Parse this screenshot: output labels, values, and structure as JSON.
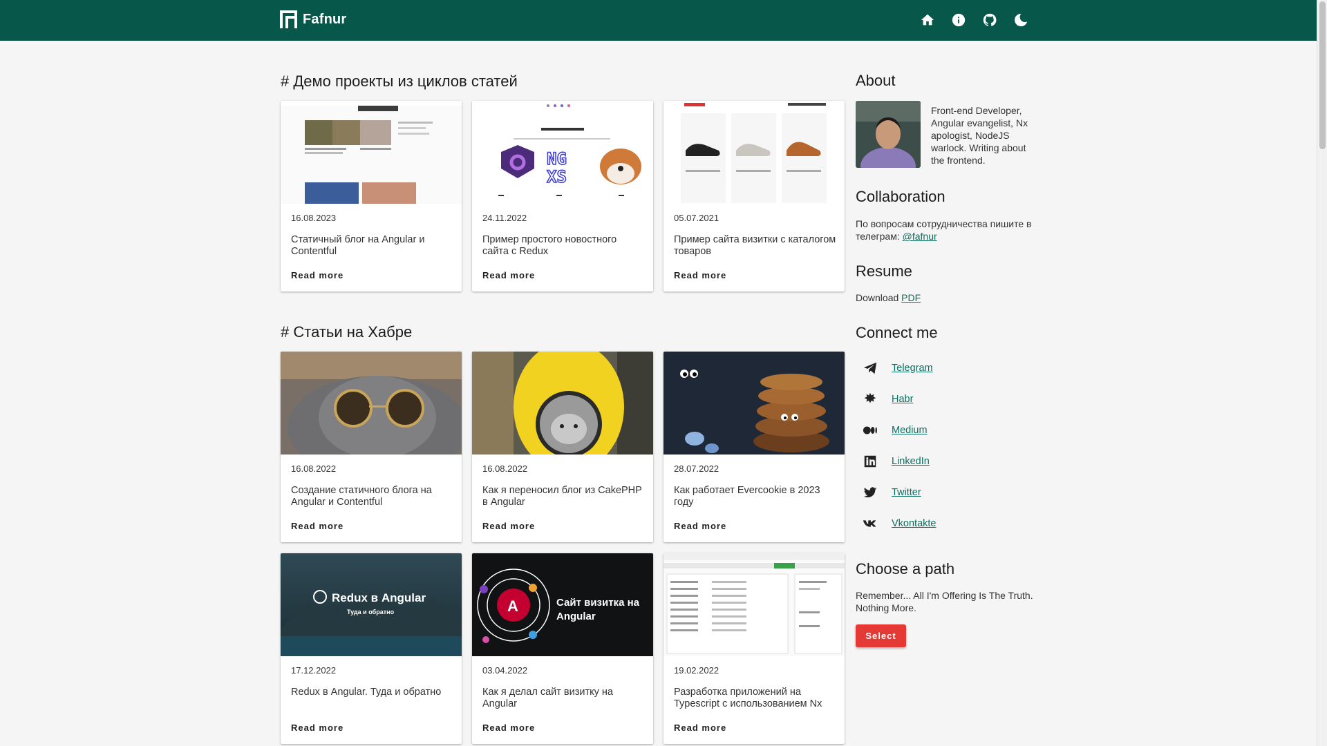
{
  "header": {
    "brand": "Fafnur",
    "icons": [
      "home-icon",
      "info-icon",
      "github-icon",
      "moon-icon"
    ]
  },
  "sections": [
    {
      "title": "# Демо проекты из циклов статей",
      "cards": [
        {
          "date": "16.08.2023",
          "title": "Статичный блог на Angular и Contentful",
          "link": "Read more",
          "thumb": "news-blog-screenshot"
        },
        {
          "date": "24.11.2022",
          "title": "Пример простого новостного сайта с Redux",
          "link": "Read more",
          "thumb": "redux-angular-logos"
        },
        {
          "date": "05.07.2021",
          "title": "Пример сайта визитки с каталогом товаров",
          "link": "Read more",
          "thumb": "sneakers-catalog-screenshot"
        }
      ]
    },
    {
      "title": "# Статьи на Хабре",
      "cards": [
        {
          "date": "16.08.2022",
          "title": "Создание статичного блога на Angular и Contentful",
          "link": "Read more",
          "thumb": "cat-with-sunglasses"
        },
        {
          "date": "16.08.2022",
          "title": "Как я переносил блог из CakePHP в Angular",
          "link": "Read more",
          "thumb": "cat-in-backpack"
        },
        {
          "date": "28.07.2022",
          "title": "Как работает Evercookie в 2023 году",
          "link": "Read more",
          "thumb": "cookies-with-eyes"
        },
        {
          "date": "17.12.2022",
          "title": "Redux в Angular. Туда и обратно",
          "link": "Read more",
          "thumb": "redux-mountain-banner",
          "banner_title": "Redux в Angular",
          "banner_subtitle": "Туда и обратно"
        },
        {
          "date": "03.04.2022",
          "title": "Как я делал сайт визитку на Angular",
          "link": "Read more",
          "thumb": "angular-orbit-banner",
          "banner_title": "Сайт визитка на Angular"
        },
        {
          "date": "19.02.2022",
          "title": "Разработка приложений на Typescript с использованием Nx",
          "link": "Read more",
          "thumb": "nx-app-screenshot"
        }
      ]
    }
  ],
  "sidebar": {
    "about": {
      "title": "About",
      "text": "Front-end Developer, Angular evangelist, Nx apologist, NodeJS warlock. Writing about the frontend."
    },
    "collaboration": {
      "title": "Collaboration",
      "text": "По вопросам сотрудничества пишите в телеграм: ",
      "link": "@fafnur"
    },
    "resume": {
      "title": "Resume",
      "text": "Download ",
      "link": "PDF"
    },
    "connect": {
      "title": "Connect me",
      "items": [
        {
          "label": "Telegram",
          "icon": "telegram-icon"
        },
        {
          "label": "Habr",
          "icon": "habr-icon"
        },
        {
          "label": "Medium",
          "icon": "medium-icon"
        },
        {
          "label": "LinkedIn",
          "icon": "linkedin-icon"
        },
        {
          "label": "Twitter",
          "icon": "twitter-icon"
        },
        {
          "label": "Vkontakte",
          "icon": "vk-icon"
        }
      ]
    },
    "path": {
      "title": "Choose a path",
      "text": "Remember... All I'm Offering Is The Truth. Nothing More.",
      "button": "Select"
    }
  },
  "colors": {
    "header": "#07574a",
    "link": "#0c6e5f",
    "button": "#e53935",
    "background": "#f5f5f5"
  }
}
